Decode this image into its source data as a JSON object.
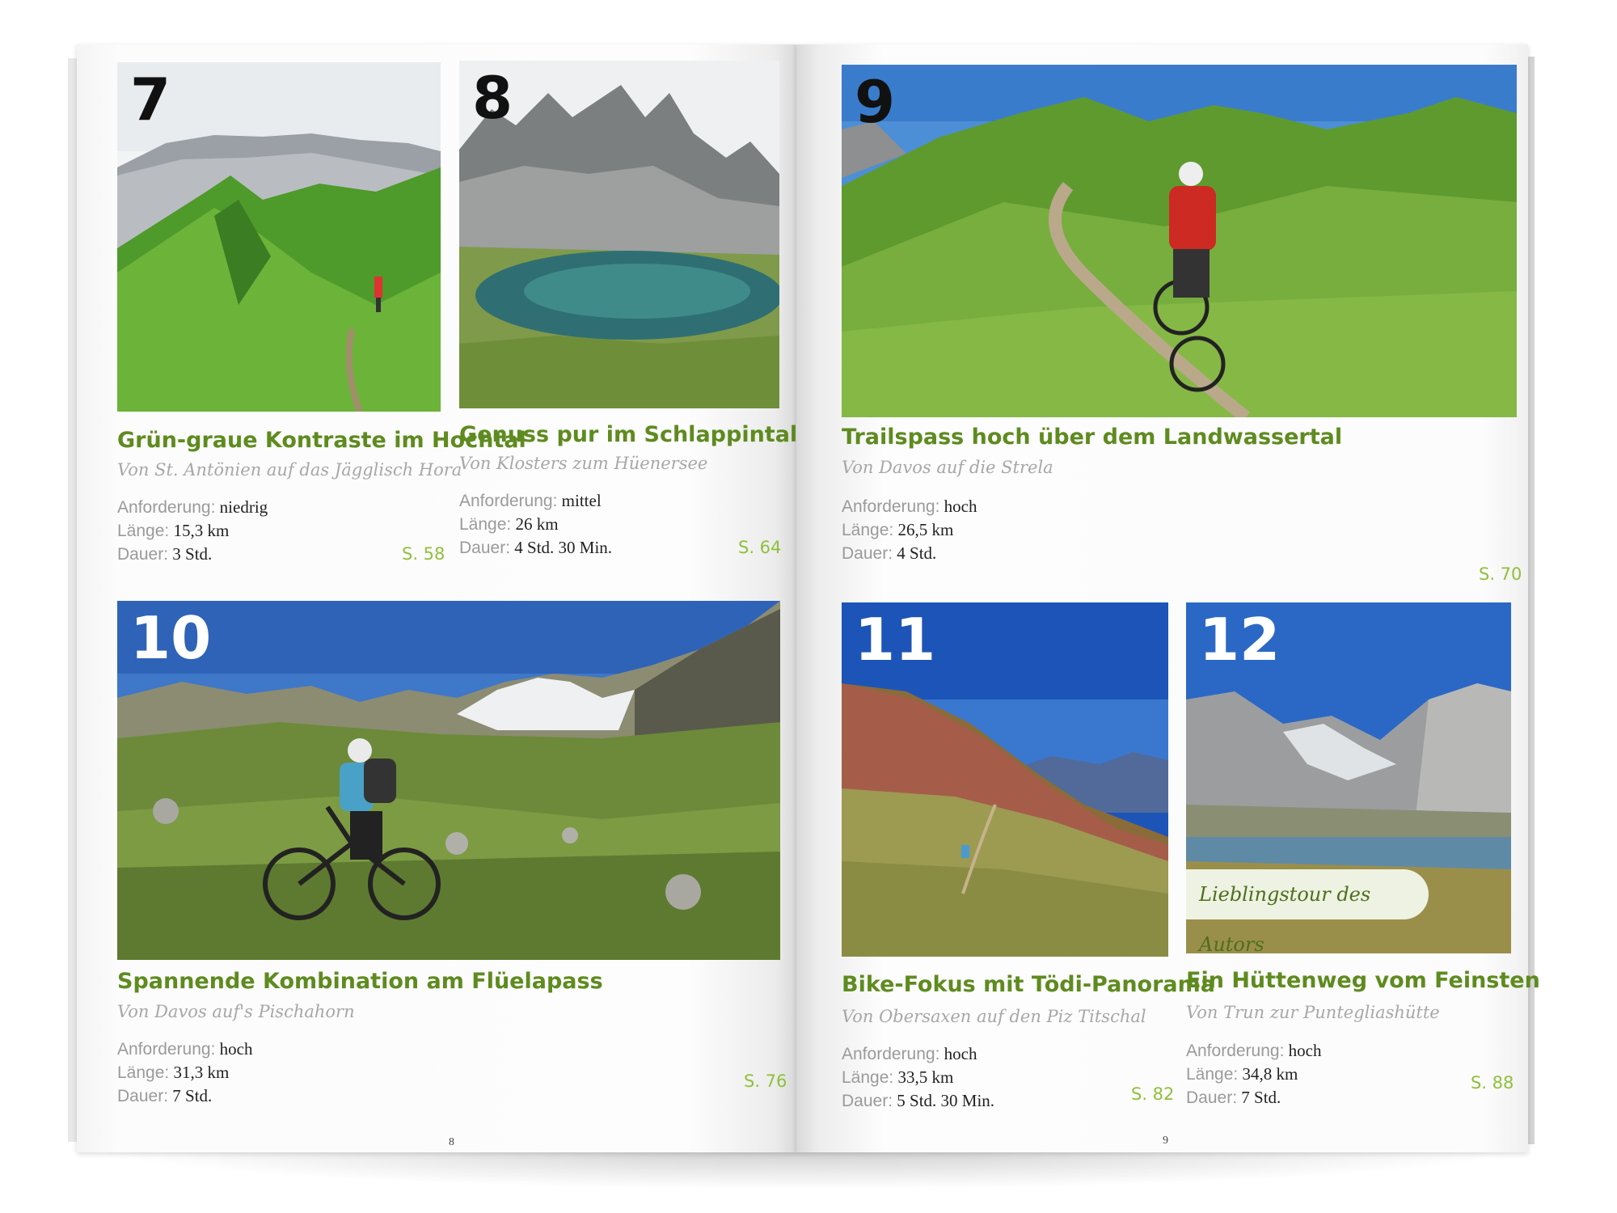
{
  "labels": {
    "anforderung": "Anforderung:",
    "laenge": "Länge:",
    "dauer": "Dauer:"
  },
  "pages": {
    "left": "8",
    "right": "9"
  },
  "accent_colors": {
    "title_green": "#5e8b1f",
    "page_ref_green": "#8fc03a"
  },
  "tours": [
    {
      "number": "7",
      "title": "Grün-graue Kontraste im Hochtal",
      "subtitle": "Von St. Antönien auf das Jägglisch Hora",
      "anforderung": "niedrig",
      "laenge": "15,3 km",
      "dauer": "3 Std.",
      "page_ref": "S. 58"
    },
    {
      "number": "8",
      "title": "Genuss pur im Schlappintal",
      "subtitle": "Von Klosters zum Hüenersee",
      "anforderung": "mittel",
      "laenge": "26 km",
      "dauer": "4 Std. 30 Min.",
      "page_ref": "S. 64"
    },
    {
      "number": "9",
      "title": "Trailspass hoch über dem Landwassertal",
      "subtitle": "Von Davos auf die Strela",
      "anforderung": "hoch",
      "laenge": "26,5 km",
      "dauer": "4 Std.",
      "page_ref": "S. 70"
    },
    {
      "number": "10",
      "title": "Spannende Kombination am Flüelapass",
      "subtitle": "Von Davos auf's Pischahorn",
      "anforderung": "hoch",
      "laenge": "31,3 km",
      "dauer": "7 Std.",
      "page_ref": "S. 76"
    },
    {
      "number": "11",
      "title": "Bike-Fokus mit Tödi-Panorama",
      "subtitle": "Von Obersaxen auf den Piz Titschal",
      "anforderung": "hoch",
      "laenge": "33,5 km",
      "dauer": "5 Std. 30 Min.",
      "page_ref": "S. 82"
    },
    {
      "number": "12",
      "title": "Ein Hüttenweg vom Feinsten",
      "subtitle": "Von Trun zur Punteglias­hütte",
      "badge": "Lieblingstour des Autors",
      "anforderung": "hoch",
      "laenge": "34,8 km",
      "dauer": "7 Std.",
      "page_ref": "S. 88"
    }
  ]
}
